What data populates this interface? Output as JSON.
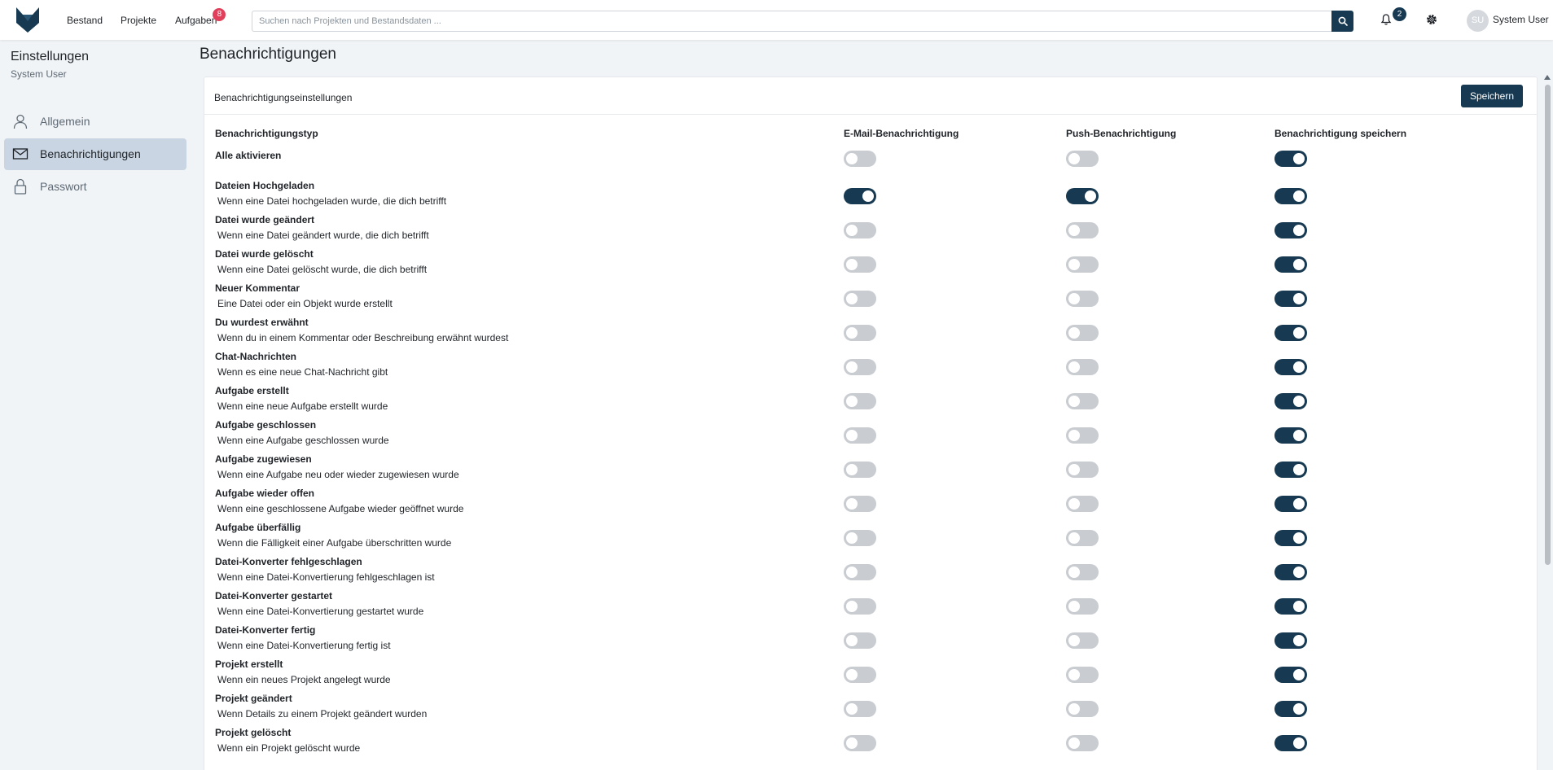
{
  "nav": {
    "items": [
      {
        "label": "Bestand"
      },
      {
        "label": "Projekte"
      },
      {
        "label": "Aufgaben",
        "badge": "8"
      }
    ],
    "search_placeholder": "Suchen nach Projekten und Bestandsdaten ...",
    "notification_count": "2",
    "user": {
      "initials": "SU",
      "name": "System User"
    }
  },
  "sidebar": {
    "title": "Einstellungen",
    "subtitle": "System User",
    "items": [
      {
        "label": "Allgemein",
        "icon": "user-icon",
        "active": false
      },
      {
        "label": "Benachrichtigungen",
        "icon": "envelope-icon",
        "active": true
      },
      {
        "label": "Passwort",
        "icon": "lock-icon",
        "active": false
      }
    ]
  },
  "page": {
    "title": "Benachrichtigungen"
  },
  "card": {
    "title": "Benachrichtigungseinstellungen",
    "save_label": "Speichern",
    "columns": [
      "Benachrichtigungstyp",
      "E-Mail-Benachrichtigung",
      "Push-Benachrichtigung",
      "Benachrichtigung speichern"
    ],
    "enable_all": {
      "label": "Alle aktivieren",
      "email": false,
      "push": false,
      "save": true
    },
    "rows": [
      {
        "title": "Dateien Hochgeladen",
        "desc": "Wenn eine Datei hochgeladen wurde, die dich betrifft",
        "email": true,
        "push": true,
        "save": true
      },
      {
        "title": "Datei wurde geändert",
        "desc": "Wenn eine Datei geändert wurde, die dich betrifft",
        "email": false,
        "push": false,
        "save": true
      },
      {
        "title": "Datei wurde gelöscht",
        "desc": "Wenn eine Datei gelöscht wurde, die dich betrifft",
        "email": false,
        "push": false,
        "save": true
      },
      {
        "title": "Neuer Kommentar",
        "desc": "Eine Datei oder ein Objekt wurde erstellt",
        "email": false,
        "push": false,
        "save": true
      },
      {
        "title": "Du wurdest erwähnt",
        "desc": "Wenn du in einem Kommentar oder Beschreibung erwähnt wurdest",
        "email": false,
        "push": false,
        "save": true
      },
      {
        "title": "Chat-Nachrichten",
        "desc": "Wenn es eine neue Chat-Nachricht gibt",
        "email": false,
        "push": false,
        "save": true
      },
      {
        "title": "Aufgabe erstellt",
        "desc": "Wenn eine neue Aufgabe erstellt wurde",
        "email": false,
        "push": false,
        "save": true
      },
      {
        "title": "Aufgabe geschlossen",
        "desc": "Wenn eine Aufgabe geschlossen wurde",
        "email": false,
        "push": false,
        "save": true
      },
      {
        "title": "Aufgabe zugewiesen",
        "desc": "Wenn eine Aufgabe neu oder wieder zugewiesen wurde",
        "email": false,
        "push": false,
        "save": true
      },
      {
        "title": "Aufgabe wieder offen",
        "desc": "Wenn eine geschlossene Aufgabe wieder geöffnet wurde",
        "email": false,
        "push": false,
        "save": true
      },
      {
        "title": "Aufgabe überfällig",
        "desc": "Wenn die Fälligkeit einer Aufgabe überschritten wurde",
        "email": false,
        "push": false,
        "save": true
      },
      {
        "title": "Datei-Konverter fehlgeschlagen",
        "desc": "Wenn eine Datei-Konvertierung fehlgeschlagen ist",
        "email": false,
        "push": false,
        "save": true
      },
      {
        "title": "Datei-Konverter gestartet",
        "desc": "Wenn eine Datei-Konvertierung gestartet wurde",
        "email": false,
        "push": false,
        "save": true
      },
      {
        "title": "Datei-Konverter fertig",
        "desc": "Wenn eine Datei-Konvertierung fertig ist",
        "email": false,
        "push": false,
        "save": true
      },
      {
        "title": "Projekt erstellt",
        "desc": "Wenn ein neues Projekt angelegt wurde",
        "email": false,
        "push": false,
        "save": true
      },
      {
        "title": "Projekt geändert",
        "desc": "Wenn Details zu einem Projekt geändert wurden",
        "email": false,
        "push": false,
        "save": true
      },
      {
        "title": "Projekt gelöscht",
        "desc": "Wenn ein Projekt gelöscht wurde",
        "email": false,
        "push": false,
        "save": true
      }
    ]
  },
  "colors": {
    "primary": "#173a52",
    "badge": "#e0405b",
    "toggle_off": "#c9ccd0",
    "active_nav": "#c9d5e2"
  }
}
